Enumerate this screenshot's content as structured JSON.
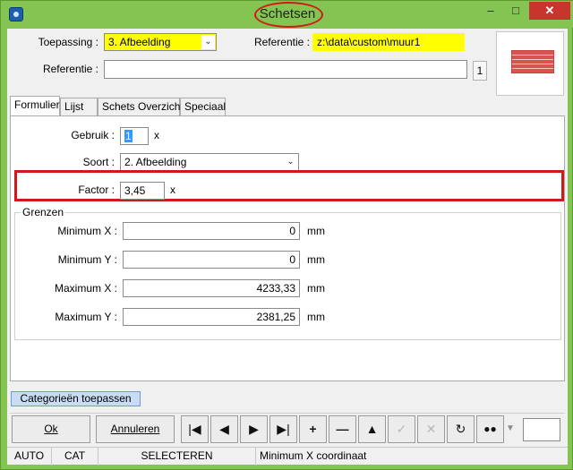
{
  "window": {
    "title": "Schetsen"
  },
  "header": {
    "toepassing_label": "Toepassing :",
    "toepassing_value": "3. Afbeelding",
    "referentie_label": "Referentie :",
    "referentie_path": "z:\\data\\custom\\muur1",
    "referentie2_label": "Referentie :",
    "referentie2_value": "",
    "ref_count": "1"
  },
  "tabs": [
    "Formulier",
    "Lijst",
    "Schets Overzicht",
    "Speciaal"
  ],
  "form": {
    "gebruik_label": "Gebruik :",
    "gebruik_value": "1",
    "gebruik_unit": "x",
    "soort_label": "Soort :",
    "soort_value": "2. Afbeelding",
    "factor_label": "Factor :",
    "factor_value": "3,45",
    "factor_unit": "x"
  },
  "grenzen": {
    "title": "Grenzen",
    "rows": [
      {
        "label": "Minimum X :",
        "value": "0",
        "unit": "mm"
      },
      {
        "label": "Minimum Y :",
        "value": "0",
        "unit": "mm"
      },
      {
        "label": "Maximum X :",
        "value": "4233,33",
        "unit": "mm"
      },
      {
        "label": "Maximum Y :",
        "value": "2381,25",
        "unit": "mm"
      }
    ]
  },
  "category_button": "Categorieën toepassen",
  "buttons": {
    "ok": "Ok",
    "annuleren": "Annuleren"
  },
  "nav_icons": [
    "first",
    "prev",
    "next",
    "last",
    "add",
    "remove",
    "up",
    "confirm",
    "cancel",
    "refresh",
    "find"
  ],
  "status": {
    "auto": "AUTO",
    "cat": "CAT",
    "mode": "SELECTEREN",
    "hint": "Minimum X coordinaat"
  },
  "colors": {
    "highlight_field": "#ffff00",
    "annotation_red": "#d01a1a",
    "frame_green": "#84c452"
  }
}
